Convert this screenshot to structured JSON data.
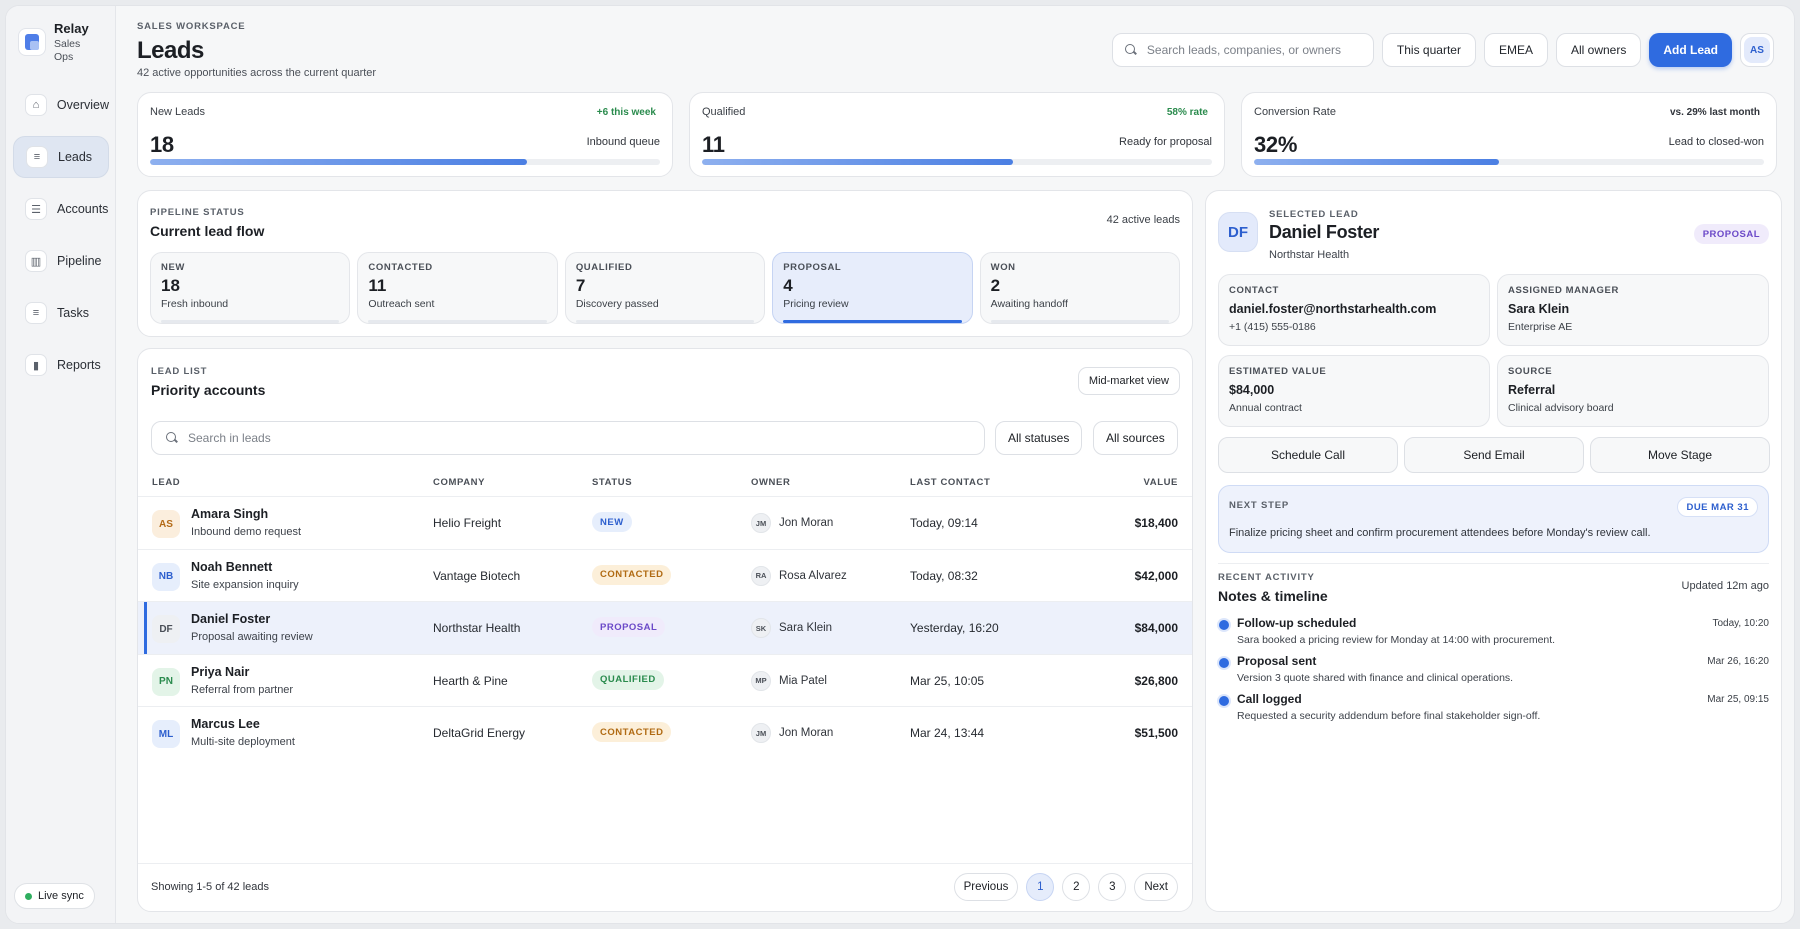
{
  "sidebar": {
    "brand_name": "Relay",
    "brand_sub_1": "Sales",
    "brand_sub_2": "Ops",
    "items": [
      {
        "label": "Overview",
        "icon": "home-icon",
        "glyph": "⌂"
      },
      {
        "label": "Leads",
        "icon": "list-icon",
        "glyph": "≡"
      },
      {
        "label": "Accounts",
        "icon": "accounts-icon",
        "glyph": "☰"
      },
      {
        "label": "Pipeline",
        "icon": "pipeline-icon",
        "glyph": "▥"
      },
      {
        "label": "Tasks",
        "icon": "tasks-icon",
        "glyph": "≡"
      },
      {
        "label": "Reports",
        "icon": "bar-chart-icon",
        "glyph": "▮"
      }
    ],
    "live_sync": "Live sync"
  },
  "header": {
    "eyebrow": "SALES WORKSPACE",
    "title": "Leads",
    "subtitle": "42 active opportunities across the current quarter",
    "search_placeholder": "Search leads, companies, or owners",
    "filter_period": "This quarter",
    "filter_region": "EMEA",
    "filter_owner": "All owners",
    "add_button": "Add Lead",
    "user_initials": "AS"
  },
  "stats": [
    {
      "label": "New Leads",
      "badge": "+6 this week",
      "value": "18",
      "desc": "Inbound queue",
      "progress_pct": 74
    },
    {
      "label": "Qualified",
      "badge": "58% rate",
      "value": "11",
      "desc": "Ready for proposal",
      "progress_pct": 61
    },
    {
      "label": "Conversion Rate",
      "badge": "vs. 29% last month",
      "value": "32%",
      "desc": "Lead to closed-won",
      "progress_pct": 48
    }
  ],
  "pipeline": {
    "eyebrow": "PIPELINE STATUS",
    "title": "Current lead flow",
    "count": "42 active leads",
    "stages": [
      {
        "name": "NEW",
        "value": "18",
        "desc": "Fresh inbound"
      },
      {
        "name": "CONTACTED",
        "value": "11",
        "desc": "Outreach sent"
      },
      {
        "name": "QUALIFIED",
        "value": "7",
        "desc": "Discovery passed"
      },
      {
        "name": "PROPOSAL",
        "value": "4",
        "desc": "Pricing review"
      },
      {
        "name": "WON",
        "value": "2",
        "desc": "Awaiting handoff"
      }
    ]
  },
  "lead_list": {
    "eyebrow": "LEAD LIST",
    "title": "Priority accounts",
    "view_button": "Mid-market view",
    "search_placeholder": "Search in leads",
    "filter_status": "All statuses",
    "filter_source": "All sources",
    "columns": [
      "LEAD",
      "COMPANY",
      "STATUS",
      "OWNER",
      "LAST CONTACT",
      "VALUE"
    ],
    "rows": [
      {
        "initials": "AS",
        "name": "Amara Singh",
        "sub": "Inbound demo request",
        "company": "Helio Freight",
        "status": "NEW",
        "owner_initials": "JM",
        "owner": "Jon Moran",
        "last_contact": "Today, 09:14",
        "value": "$18,400"
      },
      {
        "initials": "NB",
        "name": "Noah Bennett",
        "sub": "Site expansion inquiry",
        "company": "Vantage Biotech",
        "status": "CONTACTED",
        "owner_initials": "RA",
        "owner": "Rosa Alvarez",
        "last_contact": "Today, 08:32",
        "value": "$42,000"
      },
      {
        "initials": "DF",
        "name": "Daniel Foster",
        "sub": "Proposal awaiting review",
        "company": "Northstar Health",
        "status": "PROPOSAL",
        "owner_initials": "SK",
        "owner": "Sara Klein",
        "last_contact": "Yesterday, 16:20",
        "value": "$84,000"
      },
      {
        "initials": "PN",
        "name": "Priya Nair",
        "sub": "Referral from partner",
        "company": "Hearth & Pine",
        "status": "QUALIFIED",
        "owner_initials": "MP",
        "owner": "Mia Patel",
        "last_contact": "Mar 25, 10:05",
        "value": "$26,800"
      },
      {
        "initials": "ML",
        "name": "Marcus Lee",
        "sub": "Multi-site deployment",
        "company": "DeltaGrid Energy",
        "status": "CONTACTED",
        "owner_initials": "JM",
        "owner": "Jon Moran",
        "last_contact": "Mar 24, 13:44",
        "value": "$51,500"
      }
    ],
    "showing": "Showing 1-5 of 42 leads",
    "pager": {
      "prev": "Previous",
      "pages": [
        "1",
        "2",
        "3"
      ],
      "next": "Next"
    }
  },
  "detail": {
    "initials": "DF",
    "eyebrow": "SELECTED LEAD",
    "name": "Daniel Foster",
    "company": "Northstar Health",
    "badge": "PROPOSAL",
    "contact_label": "CONTACT",
    "contact_email": "daniel.foster@northstarhealth.com",
    "contact_phone": "+1 (415) 555-0186",
    "manager_label": "ASSIGNED MANAGER",
    "manager_name": "Sara Klein",
    "manager_role": "Enterprise AE",
    "value_label": "ESTIMATED VALUE",
    "value": "$84,000",
    "value_sub": "Annual contract",
    "source_label": "SOURCE",
    "source": "Referral",
    "source_sub": "Clinical advisory board",
    "actions": [
      "Schedule Call",
      "Send Email",
      "Move Stage"
    ],
    "next_step_label": "NEXT STEP",
    "next_step_due": "DUE MAR 31",
    "next_step_text": "Finalize pricing sheet and confirm procurement attendees before Monday's review call.",
    "activity_eyebrow": "RECENT ACTIVITY",
    "activity_title": "Notes & timeline",
    "activity_updated": "Updated 12m ago",
    "timeline": [
      {
        "title": "Follow-up scheduled",
        "text": "Sara booked a pricing review for Monday at 14:00 with procurement.",
        "time": "Today, 10:20"
      },
      {
        "title": "Proposal sent",
        "text": "Version 3 quote shared with finance and clinical operations.",
        "time": "Mar 26, 16:20"
      },
      {
        "title": "Call logged",
        "text": "Requested a security addendum before final stakeholder sign-off.",
        "time": "Mar 25, 09:15"
      }
    ]
  },
  "colors": {
    "accent": "#2f6be0",
    "status_new_bg": "#e6eefc",
    "status_new_fg": "#2d5fce",
    "status_contacted_bg": "#fcefd9",
    "status_contacted_fg": "#b06a12",
    "status_proposal_bg": "#f0ebfb",
    "status_proposal_fg": "#6b49c8",
    "status_qualified_bg": "#e3f4e8",
    "status_qualified_fg": "#2a8b4d"
  }
}
